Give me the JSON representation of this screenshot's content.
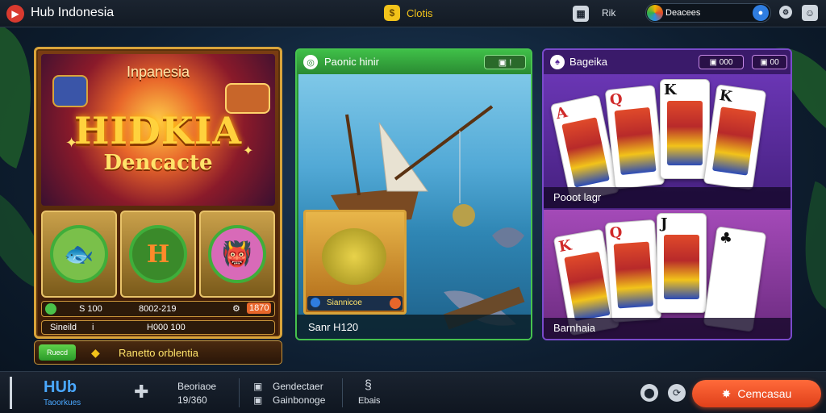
{
  "topbar": {
    "app_title": "Hub Indonesia",
    "coins_label": "Clotis",
    "mid_label": "Rik",
    "search_value": "Deacees"
  },
  "slot_game": {
    "region": "Inpanesia",
    "big_title": "HIDKIA",
    "sub_title": "Dencacte",
    "stat_left": "S 100",
    "stat_mid": "8002-219",
    "stat_right": "1870",
    "footer_left": "Sineild",
    "footer_right": "H000 100",
    "bonus_button": "Ruecd",
    "bonus_text": "Ranetto orblentia"
  },
  "fish_game": {
    "title": "Paonic hinir",
    "header_badge": "!",
    "thumb_label": "Siannicoe",
    "footer": "Sanr H120"
  },
  "card_game": {
    "title": "Bageika",
    "header_badge_1": "000",
    "header_badge_2": "00",
    "top_label": "Pooot lagr",
    "bottom_label": "Barnhaia"
  },
  "bottombar": {
    "brand_line1": "HUb",
    "brand_line2": "Taoorkues",
    "item1_line1": "Beoriaoe",
    "item1_line2": "19/360",
    "item2_line1": "Gendectaer",
    "item2_line2": "Gainbonoge",
    "item3_line1": "Ebais",
    "cta_label": "Cemcasau"
  },
  "colors": {
    "accent_orange": "#e0401a",
    "gold": "#d9a43a",
    "green": "#3fbf48",
    "purple": "#5a2a9a"
  }
}
